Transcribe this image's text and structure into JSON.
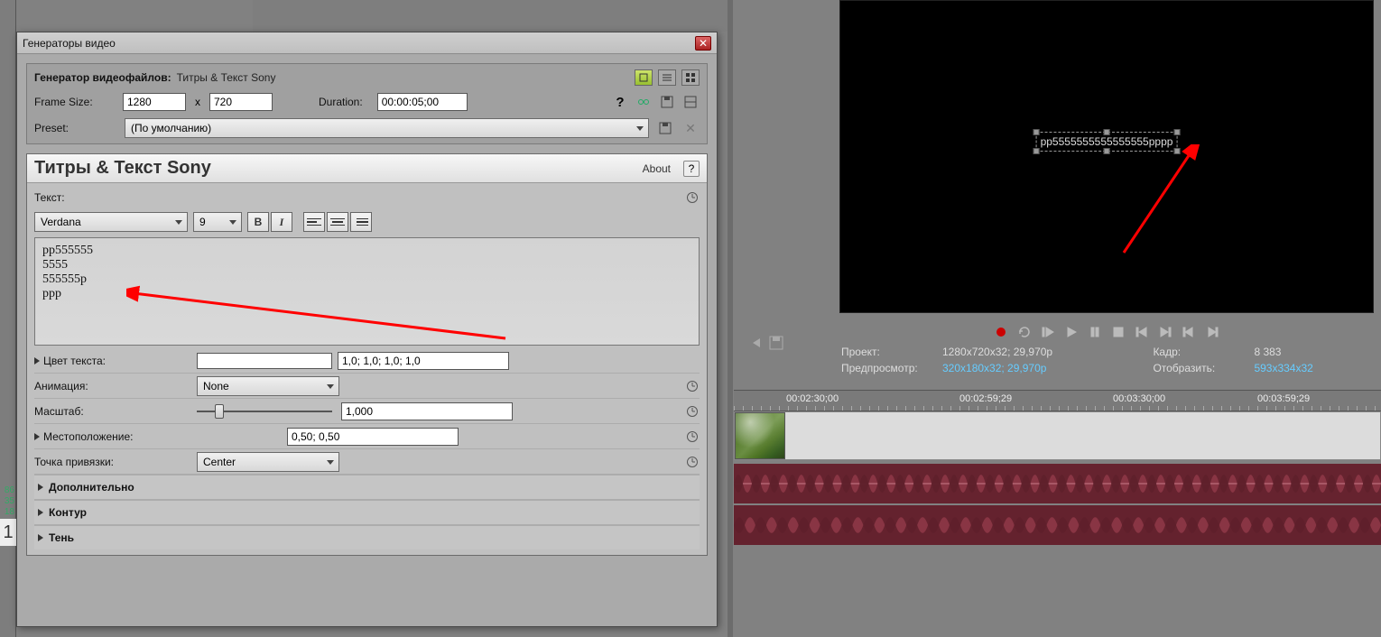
{
  "dialog": {
    "title": "Генераторы видео",
    "generator_label": "Генератор видеофайлов:",
    "generator_value": "Титры & Текст Sony",
    "frame_size_label": "Frame Size:",
    "frame_w": "1280",
    "frame_x": "x",
    "frame_h": "720",
    "duration_label": "Duration:",
    "duration_value": "00:00:05;00",
    "preset_label": "Preset:",
    "preset_value": "(По умолчанию)"
  },
  "titles": {
    "heading": "Титры & Текст Sony",
    "about": "About",
    "help": "?",
    "text_label": "Текст:",
    "font": "Verdana",
    "font_size": "9",
    "content": "pp555555\n5555\n555555p\nppp",
    "color_label": "Цвет текста:",
    "color_value": "1,0; 1,0; 1,0; 1,0",
    "animation_label": "Анимация:",
    "animation_value": "None",
    "scale_label": "Масштаб:",
    "scale_value": "1,000",
    "location_label": "Местоположение:",
    "location_value": "0,50; 0,50",
    "anchor_label": "Точка привязки:",
    "anchor_value": "Center",
    "extra_section": "Дополнительно",
    "outline_section": "Контур",
    "shadow_section": "Тень"
  },
  "preview": {
    "overlay_text": "pp5555555555555555pppp"
  },
  "info": {
    "project_label": "Проект:",
    "project_value": "1280x720x32; 29,970p",
    "kadr_label": "Кадр:",
    "kadr_value": "8 383",
    "preview_label": "Предпросмотр:",
    "preview_value": "320x180x32; 29,970p",
    "display_label": "Отобразить:",
    "display_value": "593x334x32"
  },
  "ruler": {
    "t1": "00:02:30;00",
    "t2": "00:02:59;29",
    "t3": "00:03:30;00",
    "t4": "00:03:59;29"
  },
  "sliver": {
    "a": "86",
    "b": "35",
    "c": "18",
    "big": "1"
  }
}
